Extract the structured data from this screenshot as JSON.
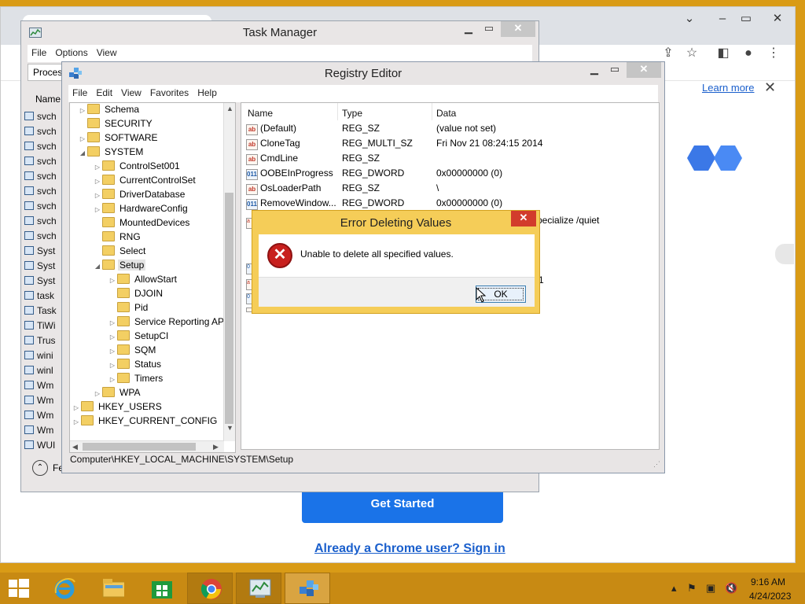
{
  "chrome": {
    "learn_more": "Learn more",
    "get_started": "Get Started",
    "sign_in": "Already a Chrome user? Sign in"
  },
  "task_manager": {
    "title": "Task Manager",
    "menu": [
      "File",
      "Options",
      "View"
    ],
    "tab_label": "Proces",
    "col_name": "Name",
    "rows": [
      "svch",
      "svch",
      "svch",
      "svch",
      "svch",
      "svch",
      "svch",
      "svch",
      "svch",
      "Syst",
      "Syst",
      "Syst",
      "task",
      "Task",
      "TiWi",
      "Trus",
      "wini",
      "winl",
      "Wm",
      "Wm",
      "Wm",
      "Wm",
      "WUI"
    ],
    "footer": "Fe"
  },
  "regedit": {
    "title": "Registry Editor",
    "menu": [
      "File",
      "Edit",
      "View",
      "Favorites",
      "Help"
    ],
    "tree": [
      {
        "label": "Schema",
        "depth": 1,
        "exp": "▷"
      },
      {
        "label": "SECURITY",
        "depth": 1,
        "exp": ""
      },
      {
        "label": "SOFTWARE",
        "depth": 1,
        "exp": "▷"
      },
      {
        "label": "SYSTEM",
        "depth": 1,
        "exp": "◢"
      },
      {
        "label": "ControlSet001",
        "depth": 2,
        "exp": "▷"
      },
      {
        "label": "CurrentControlSet",
        "depth": 2,
        "exp": "▷"
      },
      {
        "label": "DriverDatabase",
        "depth": 2,
        "exp": "▷"
      },
      {
        "label": "HardwareConfig",
        "depth": 2,
        "exp": "▷"
      },
      {
        "label": "MountedDevices",
        "depth": 2,
        "exp": ""
      },
      {
        "label": "RNG",
        "depth": 2,
        "exp": ""
      },
      {
        "label": "Select",
        "depth": 2,
        "exp": ""
      },
      {
        "label": "Setup",
        "depth": 2,
        "exp": "◢",
        "selected": true
      },
      {
        "label": "AllowStart",
        "depth": 3,
        "exp": "▷"
      },
      {
        "label": "DJOIN",
        "depth": 3,
        "exp": ""
      },
      {
        "label": "Pid",
        "depth": 3,
        "exp": ""
      },
      {
        "label": "Service Reporting API",
        "depth": 3,
        "exp": "▷"
      },
      {
        "label": "SetupCI",
        "depth": 3,
        "exp": "▷"
      },
      {
        "label": "SQM",
        "depth": 3,
        "exp": "▷"
      },
      {
        "label": "Status",
        "depth": 3,
        "exp": "▷"
      },
      {
        "label": "Timers",
        "depth": 3,
        "exp": "▷"
      },
      {
        "label": "WPA",
        "depth": 2,
        "exp": "▷"
      },
      {
        "label": "HKEY_USERS",
        "depth": 0,
        "exp": "▷"
      },
      {
        "label": "HKEY_CURRENT_CONFIG",
        "depth": 0,
        "exp": "▷"
      }
    ],
    "columns": {
      "name": "Name",
      "type": "Type",
      "data": "Data"
    },
    "values": [
      {
        "icon": "ab",
        "name": "(Default)",
        "type": "REG_SZ",
        "data": "(value not set)"
      },
      {
        "icon": "ab",
        "name": "CloneTag",
        "type": "REG_MULTI_SZ",
        "data": "Fri Nov 21 08:24:15 2014"
      },
      {
        "icon": "ab",
        "name": "CmdLine",
        "type": "REG_SZ",
        "data": ""
      },
      {
        "icon": "bin",
        "name": "OOBEInProgress",
        "type": "REG_DWORD",
        "data": "0x00000000 (0)"
      },
      {
        "icon": "ab",
        "name": "OsLoaderPath",
        "type": "REG_SZ",
        "data": "\\"
      },
      {
        "icon": "bin",
        "name": "RemoveWindow...",
        "type": "REG_DWORD",
        "data": "0x00000000 (0)"
      }
    ],
    "partial_texts": {
      "specialize": "pecialize /quiet",
      "one": "1"
    },
    "status": "Computer\\HKEY_LOCAL_MACHINE\\SYSTEM\\Setup"
  },
  "error_dialog": {
    "title": "Error Deleting Values",
    "message": "Unable to delete all specified values.",
    "ok": "OK"
  },
  "taskbar": {
    "time": "9:16 AM",
    "date": "4/24/2023"
  }
}
